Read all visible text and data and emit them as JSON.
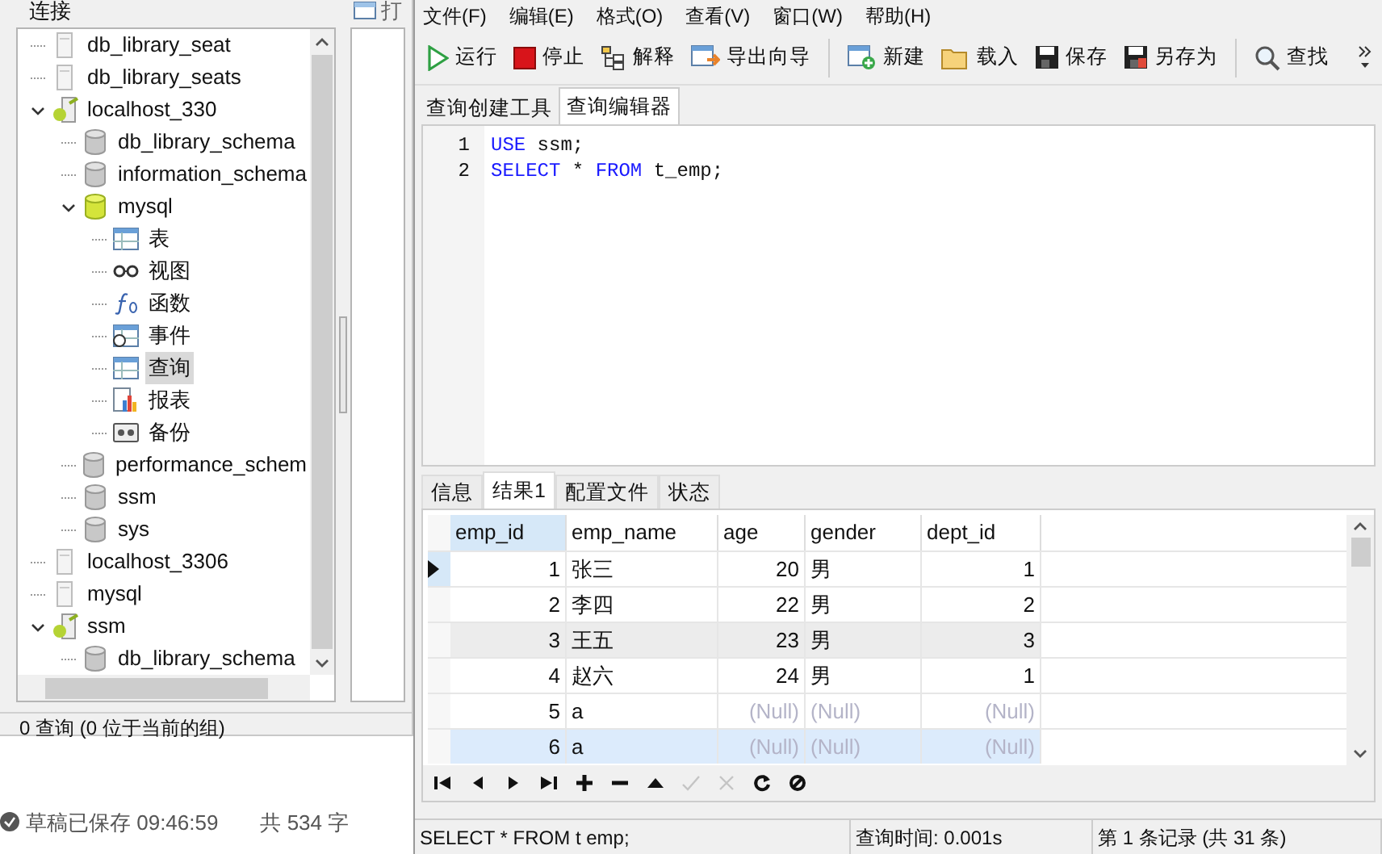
{
  "background_page": {
    "draft_status": "草稿已保存 09:46:59",
    "word_count": "共 534 字"
  },
  "connection_panel": {
    "title": "连接",
    "partial_tab": "打",
    "tree": [
      {
        "label": "db_library_seat",
        "kind": "server",
        "selected": false
      },
      {
        "label": "db_library_seats",
        "kind": "server",
        "selected": false
      },
      {
        "label": "localhost_330",
        "kind": "server_open",
        "expanded": true,
        "selected": false,
        "children": [
          {
            "label": "db_library_schema",
            "kind": "database",
            "selected": false
          },
          {
            "label": "information_schema",
            "kind": "database",
            "selected": false
          },
          {
            "label": "mysql",
            "kind": "database_open",
            "expanded": true,
            "selected": false,
            "children": [
              {
                "label": "表",
                "kind": "table",
                "selected": false
              },
              {
                "label": "视图",
                "kind": "view",
                "selected": false
              },
              {
                "label": "函数",
                "kind": "function",
                "selected": false
              },
              {
                "label": "事件",
                "kind": "event",
                "selected": false
              },
              {
                "label": "查询",
                "kind": "query",
                "selected": true
              },
              {
                "label": "报表",
                "kind": "report",
                "selected": false
              },
              {
                "label": "备份",
                "kind": "backup",
                "selected": false
              }
            ]
          },
          {
            "label": "performance_schem",
            "kind": "database",
            "selected": false
          },
          {
            "label": "ssm",
            "kind": "database",
            "selected": false
          },
          {
            "label": "sys",
            "kind": "database",
            "selected": false
          }
        ]
      },
      {
        "label": "localhost_3306",
        "kind": "server",
        "selected": false
      },
      {
        "label": "mysql",
        "kind": "server",
        "selected": false
      },
      {
        "label": "ssm",
        "kind": "server_open",
        "expanded": true,
        "selected": false,
        "children": [
          {
            "label": "db_library_schema",
            "kind": "database",
            "selected": false
          }
        ]
      }
    ],
    "status": "0 查询 (0 位于当前的组)"
  },
  "query_window": {
    "menu": [
      "文件(F)",
      "编辑(E)",
      "格式(O)",
      "查看(V)",
      "窗口(W)",
      "帮助(H)"
    ],
    "toolbar": [
      {
        "label": "运行",
        "kind": "run"
      },
      {
        "label": "停止",
        "kind": "stop"
      },
      {
        "label": "解释",
        "kind": "explain"
      },
      {
        "label": "导出向导",
        "kind": "export"
      },
      {
        "kind": "separator"
      },
      {
        "label": "新建",
        "kind": "new"
      },
      {
        "label": "载入",
        "kind": "load"
      },
      {
        "label": "保存",
        "kind": "save"
      },
      {
        "label": "另存为",
        "kind": "save_as"
      },
      {
        "kind": "separator"
      },
      {
        "label": "查找",
        "kind": "find"
      }
    ],
    "tabs": [
      {
        "label": "查询创建工具",
        "selected": false
      },
      {
        "label": "查询编辑器",
        "selected": true
      }
    ],
    "editor_lines": [
      {
        "number": "1",
        "tokens": [
          {
            "text": "USE",
            "kind": "keyword"
          },
          {
            "text": " ssm;",
            "kind": "plain"
          }
        ]
      },
      {
        "number": "2",
        "tokens": [
          {
            "text": "SELECT",
            "kind": "keyword"
          },
          {
            "text": " * ",
            "kind": "plain"
          },
          {
            "text": "FROM",
            "kind": "keyword"
          },
          {
            "text": " t_emp;",
            "kind": "plain"
          }
        ]
      }
    ],
    "result_tabs": [
      {
        "label": "信息",
        "selected": false
      },
      {
        "label": "结果1",
        "selected": true
      },
      {
        "label": "配置文件",
        "selected": false
      },
      {
        "label": "状态",
        "selected": false
      }
    ],
    "table": {
      "columns": [
        {
          "name": "emp_id",
          "kind": "number",
          "selected": true
        },
        {
          "name": "emp_name",
          "kind": "text",
          "selected": false
        },
        {
          "name": "age",
          "kind": "number",
          "selected": false
        },
        {
          "name": "gender",
          "kind": "text",
          "selected": false
        },
        {
          "name": "dept_id",
          "kind": "number",
          "selected": false
        }
      ],
      "rows": [
        {
          "current": true,
          "hovered": false,
          "selected": false,
          "cells": [
            {
              "text": "1",
              "null": false
            },
            {
              "text": "张三",
              "null": false
            },
            {
              "text": "20",
              "null": false
            },
            {
              "text": "男",
              "null": false
            },
            {
              "text": "1",
              "null": false
            }
          ]
        },
        {
          "current": false,
          "hovered": false,
          "selected": false,
          "cells": [
            {
              "text": "2",
              "null": false
            },
            {
              "text": "李四",
              "null": false
            },
            {
              "text": "22",
              "null": false
            },
            {
              "text": "男",
              "null": false
            },
            {
              "text": "2",
              "null": false
            }
          ]
        },
        {
          "current": false,
          "hovered": true,
          "selected": false,
          "cells": [
            {
              "text": "3",
              "null": false
            },
            {
              "text": "王五",
              "null": false
            },
            {
              "text": "23",
              "null": false
            },
            {
              "text": "男",
              "null": false
            },
            {
              "text": "3",
              "null": false
            }
          ]
        },
        {
          "current": false,
          "hovered": false,
          "selected": false,
          "cells": [
            {
              "text": "4",
              "null": false
            },
            {
              "text": "赵六",
              "null": false
            },
            {
              "text": "24",
              "null": false
            },
            {
              "text": "男",
              "null": false
            },
            {
              "text": "1",
              "null": false
            }
          ]
        },
        {
          "current": false,
          "hovered": false,
          "selected": false,
          "cells": [
            {
              "text": "5",
              "null": false
            },
            {
              "text": "a",
              "null": false
            },
            {
              "text": "(Null)",
              "null": true
            },
            {
              "text": "(Null)",
              "null": true
            },
            {
              "text": "(Null)",
              "null": true
            }
          ]
        },
        {
          "current": false,
          "hovered": false,
          "selected": true,
          "cells": [
            {
              "text": "6",
              "null": false
            },
            {
              "text": "a",
              "null": false
            },
            {
              "text": "(Null)",
              "null": true
            },
            {
              "text": "(Null)",
              "null": true
            },
            {
              "text": "(Null)",
              "null": true
            }
          ]
        }
      ]
    },
    "nav_buttons": [
      {
        "kind": "first",
        "disabled": false
      },
      {
        "kind": "prev",
        "disabled": false
      },
      {
        "kind": "next",
        "disabled": false
      },
      {
        "kind": "last",
        "disabled": false
      },
      {
        "kind": "add",
        "disabled": false
      },
      {
        "kind": "remove",
        "disabled": false
      },
      {
        "kind": "up",
        "disabled": false
      },
      {
        "kind": "apply",
        "disabled": true
      },
      {
        "kind": "cancel",
        "disabled": true
      },
      {
        "kind": "refresh",
        "disabled": false
      },
      {
        "kind": "stop",
        "disabled": false
      }
    ],
    "status_bar": [
      "SELECT * FROM t emp;",
      "查询时间: 0.001s",
      "第 1 条记录 (共 31 条)"
    ]
  }
}
